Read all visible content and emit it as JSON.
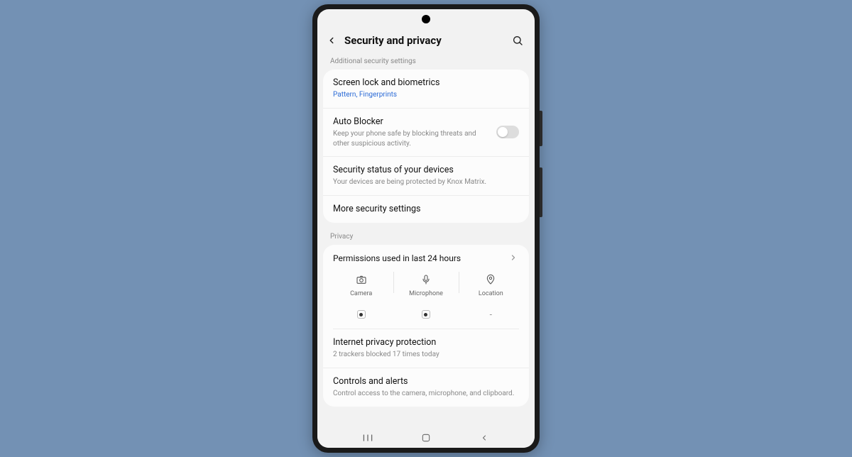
{
  "header": {
    "title": "Security and privacy"
  },
  "sections": {
    "security": {
      "label": "Additional security settings",
      "items": {
        "screenlock": {
          "title": "Screen lock and biometrics",
          "sub": "Pattern, Fingerprints"
        },
        "autoblocker": {
          "title": "Auto Blocker",
          "sub": "Keep your phone safe by blocking threats and other suspicious activity."
        },
        "status": {
          "title": "Security status of your devices",
          "sub": "Your devices are being protected by Knox Matrix."
        },
        "more": {
          "title": "More security settings"
        }
      }
    },
    "privacy": {
      "label": "Privacy",
      "permissions": {
        "title": "Permissions used in last 24 hours",
        "cols": {
          "camera": "Camera",
          "mic": "Microphone",
          "location": "Location"
        }
      },
      "internet": {
        "title": "Internet privacy protection",
        "sub": "2 trackers blocked 17 times today"
      },
      "controls": {
        "title": "Controls and alerts",
        "sub": "Control access to the camera, microphone, and clipboard."
      }
    }
  }
}
